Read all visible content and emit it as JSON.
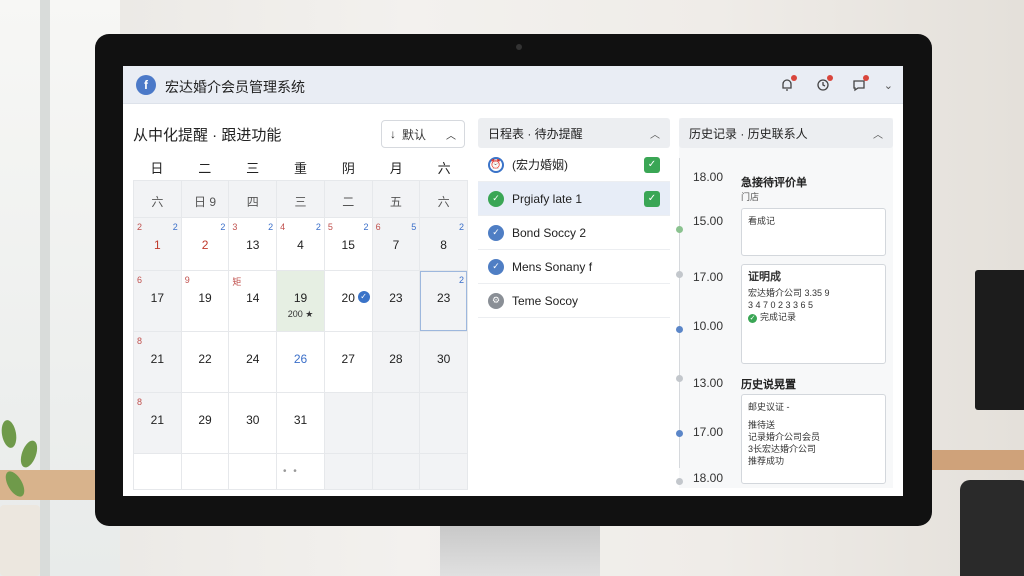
{
  "app": {
    "logo": "f",
    "title": "宏达婚介会员管理系统"
  },
  "header_icons": [
    "bell-icon",
    "clock-icon",
    "chat-icon"
  ],
  "calendar": {
    "title": "从中化提醒 · 跟进功能",
    "sort_label": "默认",
    "weekdays": [
      "日",
      "二",
      "三",
      "重",
      "阴",
      "月",
      "六"
    ],
    "header_row": [
      "六",
      "日 9",
      "四",
      "三",
      "二",
      "五",
      "六"
    ],
    "rows": [
      [
        {
          "tl": "2",
          "tr": "2",
          "num": "1",
          "red": true
        },
        {
          "tl": "",
          "tr": "2",
          "num": "2",
          "red": true
        },
        {
          "tl": "3",
          "tr": "2",
          "num": "13"
        },
        {
          "tl": "4",
          "tr": "2",
          "num": "4"
        },
        {
          "tl": "5",
          "tr": "2",
          "num": "15"
        },
        {
          "tl": "6",
          "tr": "5",
          "num": "7"
        },
        {
          "tl": "",
          "tr": "2",
          "num": "8"
        }
      ],
      [
        {
          "tl": "6",
          "tr": "",
          "num": "17"
        },
        {
          "tl": "9",
          "tr": "",
          "num": "19"
        },
        {
          "tl": "矩",
          "tr": "",
          "num": "14"
        },
        {
          "tl": "",
          "tr": "",
          "num": "19",
          "sub": "200 ★"
        },
        {
          "tl": "",
          "tr": "",
          "num": "20"
        },
        {
          "tl": "",
          "tr": "",
          "num": "23"
        },
        {
          "tl": "",
          "tr": "2",
          "num": "23"
        }
      ],
      [
        {
          "tl": "8",
          "tr": "",
          "num": "21"
        },
        {
          "tl": "",
          "tr": "",
          "num": "22"
        },
        {
          "tl": "",
          "tr": "",
          "num": "24"
        },
        {
          "tl": "",
          "tr": "",
          "num": "26"
        },
        {
          "tl": "",
          "tr": "",
          "num": "27"
        },
        {
          "tl": "",
          "tr": "",
          "num": "28"
        },
        {
          "tl": "",
          "tr": "",
          "num": "30"
        }
      ],
      [
        {
          "tl": "8",
          "tr": "",
          "num": "21"
        },
        {
          "tl": "",
          "tr": "",
          "num": "29"
        },
        {
          "tl": "",
          "tr": "",
          "num": "30"
        },
        {
          "tl": "",
          "tr": "",
          "num": "31"
        },
        {
          "tl": "",
          "tr": "",
          "num": ""
        },
        {
          "tl": "",
          "tr": "",
          "num": ""
        },
        {
          "tl": "",
          "tr": "",
          "num": ""
        }
      ]
    ],
    "more": "• •"
  },
  "schedule": {
    "header": "日程表 · 待办提醒",
    "items": [
      {
        "label": "(宏力婚姻)",
        "icon": "alarm-icon",
        "checked": true
      },
      {
        "label": "Prgiafy late 1",
        "icon": "check-circle-icon",
        "checked": true
      },
      {
        "label": "Bond Soccy 2",
        "icon": "check-circle-icon",
        "checked": false
      },
      {
        "label": "Mens Sonany f",
        "icon": "check-circle-icon",
        "checked": false
      },
      {
        "label": "Teme Socoy",
        "icon": "gear-icon",
        "checked": false
      }
    ]
  },
  "history": {
    "header": "历史记录 · 历史联系人",
    "times": [
      "18.00",
      "15.00",
      "17.00",
      "10.00",
      "13.00",
      "17.00",
      "18.00"
    ],
    "block1": {
      "title": "急接待评价单",
      "sub": "门店",
      "box": "看成记"
    },
    "block2": {
      "title": "证明成",
      "lines": [
        "宏达婚介公司 3.35 9",
        "3 4 7 0 2 3 3 6 5",
        "完成记录"
      ]
    },
    "block3": {
      "title": "历史说晃置",
      "line1": "邮史议证 -",
      "lines": [
        "推待送",
        "记录婚介公司会员",
        "3长宏达婚介公司",
        "推荐成功"
      ]
    }
  }
}
